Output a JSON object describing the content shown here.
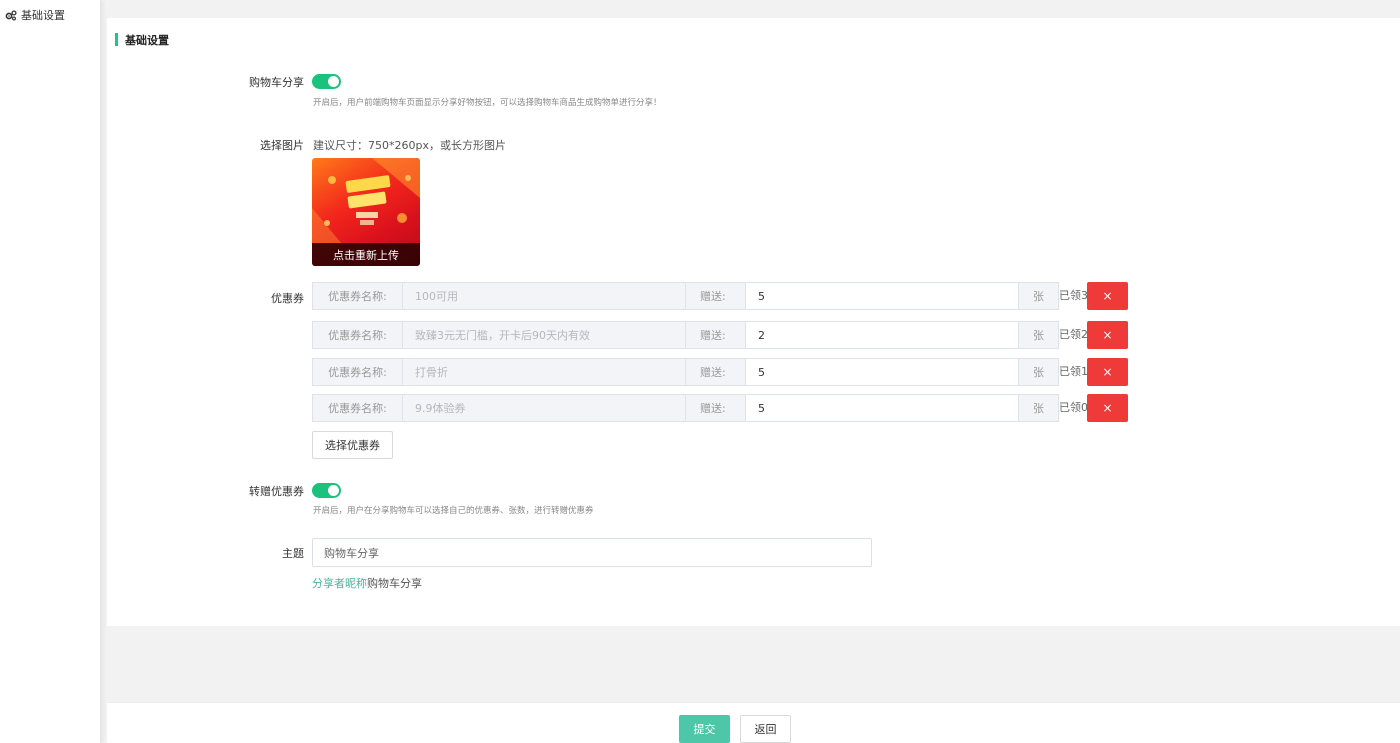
{
  "sidebar": {
    "items": [
      {
        "label": "基础设置",
        "icon": "gears-icon"
      }
    ]
  },
  "section": {
    "title": "基础设置"
  },
  "cart_share": {
    "label": "购物车分享",
    "enabled": true,
    "hint": "开启后，用户前端购物车页面显示分享好物按钮，可以选择购物车商品生成购物单进行分享！"
  },
  "image": {
    "label": "选择图片",
    "size_hint": "建议尺寸：750*260px，或长方形图片",
    "overlay_text": "点击重新上传"
  },
  "coupons": {
    "label": "优惠券",
    "name_label": "优惠券名称:",
    "give_label": "赠送:",
    "unit": "张",
    "rows": [
      {
        "name": "100可用",
        "give": "5",
        "received": "已领3"
      },
      {
        "name": "致臻3元无门槛，开卡后90天内有效",
        "give": "2",
        "received": "已领2"
      },
      {
        "name": "打骨折",
        "give": "5",
        "received": "已领1"
      },
      {
        "name": "9.9体验券",
        "give": "5",
        "received": "已领0"
      }
    ],
    "delete_symbol": "×",
    "select_button": "选择优惠券"
  },
  "transfer_coupon": {
    "label": "转赠优惠券",
    "enabled": true,
    "hint": "开启后，用户在分享购物车可以选择自己的优惠券、张数，进行转赠优惠券"
  },
  "subject": {
    "label": "主题",
    "value": "购物车分享",
    "tag_link": "分享者昵称",
    "tag_suffix": "购物车分享"
  },
  "footer": {
    "submit": "提交",
    "back": "返回"
  },
  "colors": {
    "accent": "#1ec295",
    "toggle_on": "#19c37d",
    "danger": "#ef3a3a",
    "primary_button": "#4ec7a8",
    "link": "#4ab39a"
  }
}
